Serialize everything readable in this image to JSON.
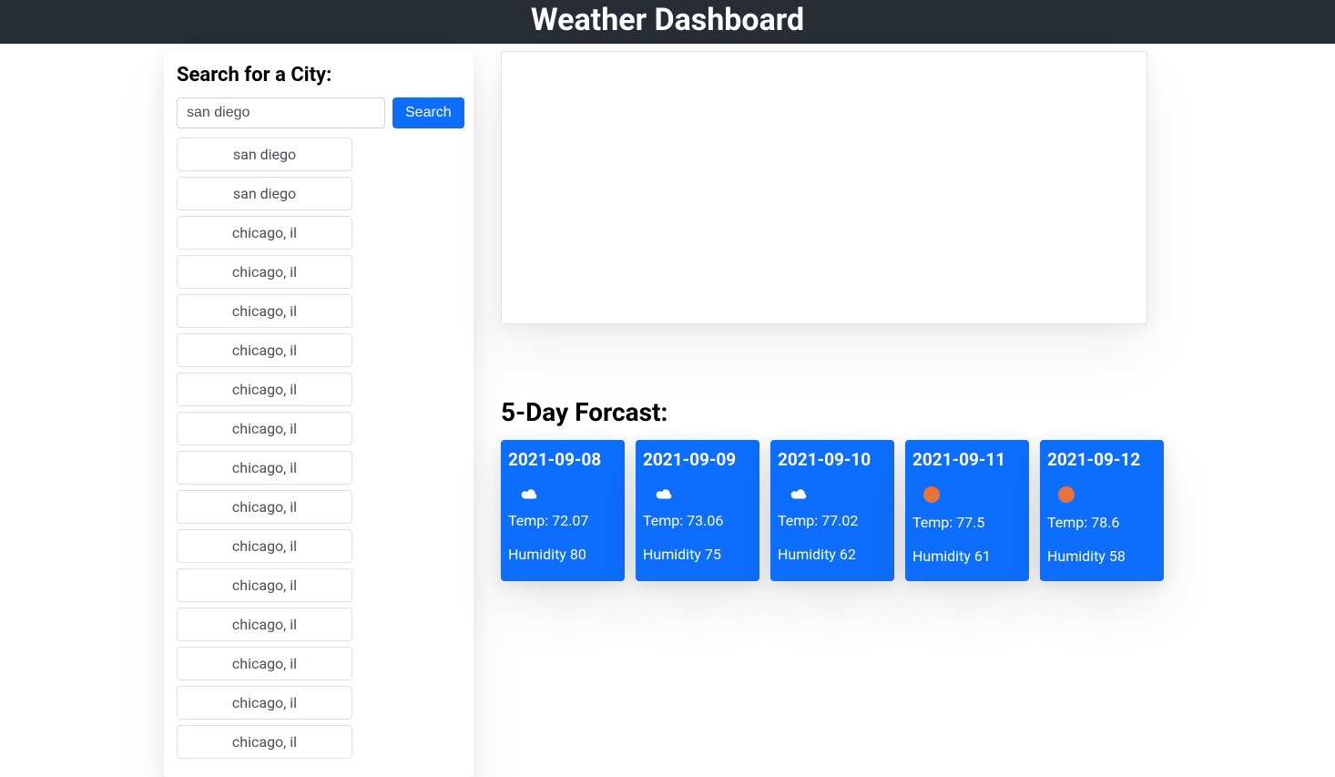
{
  "header": {
    "title": "Weather Dashboard"
  },
  "sidebar": {
    "title": "Search for a City:",
    "search_value": "san diego",
    "search_button_label": "Search",
    "history": [
      "san diego",
      "san diego",
      "chicago, il",
      "chicago, il",
      "chicago, il",
      "chicago, il",
      "chicago, il",
      "chicago, il",
      "chicago, il",
      "chicago, il",
      "chicago, il",
      "chicago, il",
      "chicago, il",
      "chicago, il",
      "chicago, il",
      "chicago, il"
    ]
  },
  "forecast": {
    "title": "5-Day Forcast:",
    "days": [
      {
        "date": "2021-09-08",
        "icon": "cloud",
        "temp_label": "Temp: 72.07",
        "humidity_label": "Humidity 80"
      },
      {
        "date": "2021-09-09",
        "icon": "cloud",
        "temp_label": "Temp: 73.06",
        "humidity_label": "Humidity 75"
      },
      {
        "date": "2021-09-10",
        "icon": "cloud",
        "temp_label": "Temp: 77.02",
        "humidity_label": "Humidity 62"
      },
      {
        "date": "2021-09-11",
        "icon": "sun",
        "temp_label": "Temp: 77.5",
        "humidity_label": "Humidity 61"
      },
      {
        "date": "2021-09-12",
        "icon": "sun",
        "temp_label": "Temp: 78.6",
        "humidity_label": "Humidity 58"
      }
    ]
  }
}
